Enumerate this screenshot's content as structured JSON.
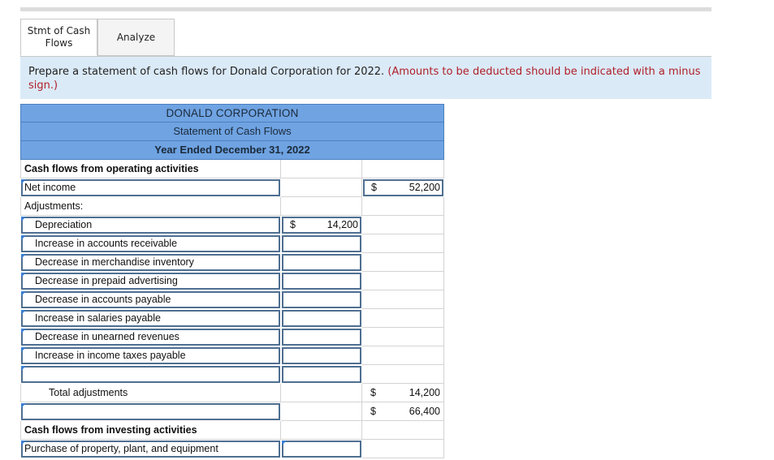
{
  "tabs": [
    {
      "label": "Stmt of Cash Flows"
    },
    {
      "label": "Analyze"
    }
  ],
  "instructions": {
    "main": "Prepare a statement of cash flows for Donald Corporation for 2022.",
    "note": "(Amounts to be deducted should be indicated with a minus sign.)"
  },
  "statement": {
    "company": "DONALD CORPORATION",
    "title": "Statement of Cash Flows",
    "period": "Year Ended December 31, 2022",
    "operating_heading": "Cash flows from operating activities",
    "net_income": {
      "label": "Net income",
      "currency": "$",
      "value": "52,200"
    },
    "adjustments_label": "Adjustments:",
    "adjustments": [
      {
        "label": "Depreciation",
        "currency": "$",
        "value": "14,200"
      },
      {
        "label": "Increase in accounts receivable",
        "currency": "",
        "value": ""
      },
      {
        "label": "Decrease in merchandise inventory",
        "currency": "",
        "value": ""
      },
      {
        "label": "Decrease in prepaid advertising",
        "currency": "",
        "value": ""
      },
      {
        "label": "Decrease in accounts payable",
        "currency": "",
        "value": ""
      },
      {
        "label": "Increase in salaries payable",
        "currency": "",
        "value": ""
      },
      {
        "label": "Decrease in unearned revenues",
        "currency": "",
        "value": ""
      },
      {
        "label": "Increase in income taxes payable",
        "currency": "",
        "value": ""
      },
      {
        "label": "",
        "currency": "",
        "value": ""
      }
    ],
    "total_adjustments": {
      "label": "Total adjustments",
      "currency": "$",
      "value": "14,200"
    },
    "operating_total": {
      "label": "",
      "currency": "$",
      "value": "66,400"
    },
    "investing_heading": "Cash flows from investing activities",
    "investing_items": [
      {
        "label": "Purchase of property, plant, and equipment",
        "value": ""
      }
    ]
  }
}
